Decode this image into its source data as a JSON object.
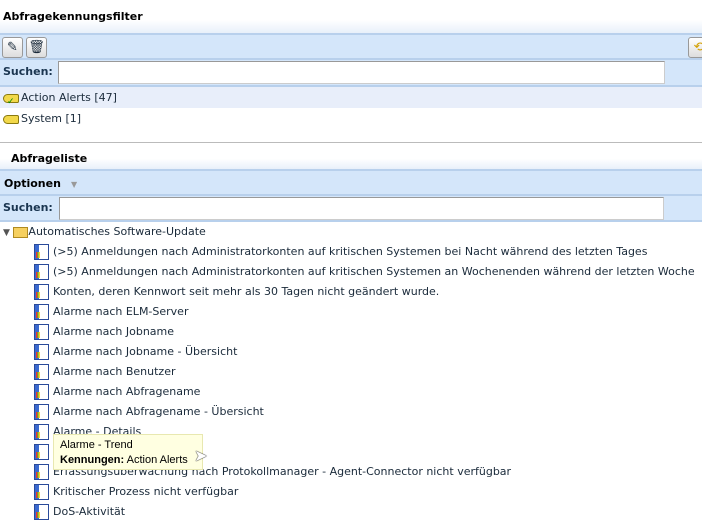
{
  "filter_panel": {
    "title": "Abfragekennungsfilter",
    "search_label": "Suchen:",
    "search_value": "",
    "tags": [
      {
        "label": "Action Alerts [47]",
        "selected": true
      },
      {
        "label": "System [1]",
        "selected": false
      }
    ]
  },
  "list_panel": {
    "title": "Abfrageliste",
    "options_label": "Optionen",
    "search_label": "Suchen:",
    "search_value": "",
    "folder": "Automatisches Software-Update",
    "items": [
      "(>5) Anmeldungen nach Administratorkonten auf kritischen Systemen bei Nacht während des letzten Tages",
      "(>5) Anmeldungen nach Administratorkonten auf kritischen Systemen an Wochenenden während der letzten Woche",
      "Konten, deren Kennwort seit mehr als 30 Tagen nicht geändert wurde.",
      "Alarme nach ELM-Server",
      "Alarme nach Jobname",
      "Alarme nach Jobname - Übersicht",
      "Alarme nach Benutzer",
      "Alarme nach Abfragename",
      "Alarme nach Abfragename - Übersicht",
      "Alarme - Details",
      "Alarme - Trend",
      "Erfassungsüberwachung nach Protokollmanager - Agent-Connector nicht verfügbar",
      "Kritischer Prozess nicht verfügbar",
      "DoS-Aktivität"
    ]
  },
  "tooltip": {
    "title": "Alarme - Trend",
    "key": "Kennungen:",
    "value": "Action Alerts"
  }
}
